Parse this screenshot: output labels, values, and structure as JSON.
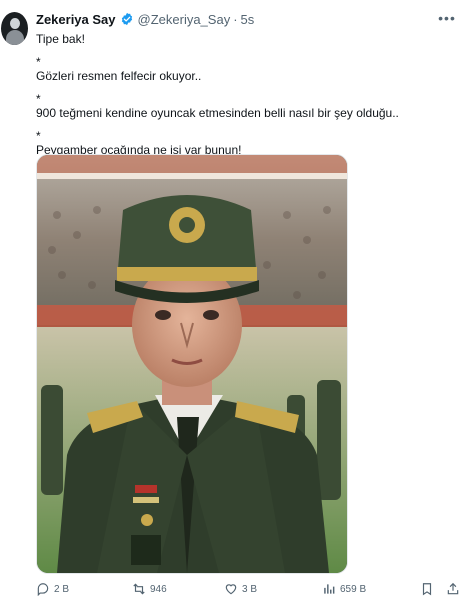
{
  "tweet": {
    "author_name": "Zekeriya Say",
    "handle": "@Zekeriya_Say",
    "separator": "·",
    "time": "5s",
    "lines": [
      "Tipe bak!",
      "*",
      "Gözleri resmen felfecir okuyor..",
      "*",
      "900 teğmeni kendine oyuncak etmesinden belli nasıl bir şey olduğu..",
      "*",
      "Peygamber ocağında ne işi var bunun!"
    ]
  },
  "actions": {
    "replies": "2 B",
    "retweets": "946",
    "likes": "3 B",
    "views": "659 B"
  },
  "colors": {
    "verified": "#1d9bf0",
    "text": "#0f1419",
    "muted": "#536471",
    "uniform": "#2f3d2b"
  }
}
